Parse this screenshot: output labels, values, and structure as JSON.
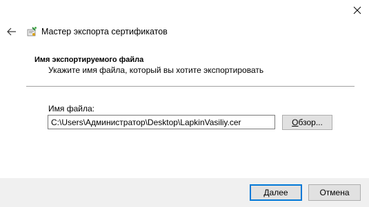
{
  "window": {
    "title": "Мастер экспорта сертификатов"
  },
  "icons": {
    "close": "close-icon",
    "back": "back-arrow-icon",
    "wizard": "certificate-wizard-icon"
  },
  "section": {
    "heading": "Имя экспортируемого файла",
    "description": "Укажите имя файла, который вы хотите экспортировать"
  },
  "form": {
    "file_label": "Имя файла:",
    "file_value": "C:\\Users\\Администратор\\Desktop\\LapkinVasiliy.cer",
    "browse_label_underlined": "О",
    "browse_label_rest": "бзор..."
  },
  "footer": {
    "next_label_underlined": "Д",
    "next_label_rest": "алее",
    "cancel_label": "Отмена"
  },
  "colors": {
    "accent": "#0078d7",
    "footer_bg": "#f0f0f0",
    "button_bg": "#e1e1e1"
  }
}
